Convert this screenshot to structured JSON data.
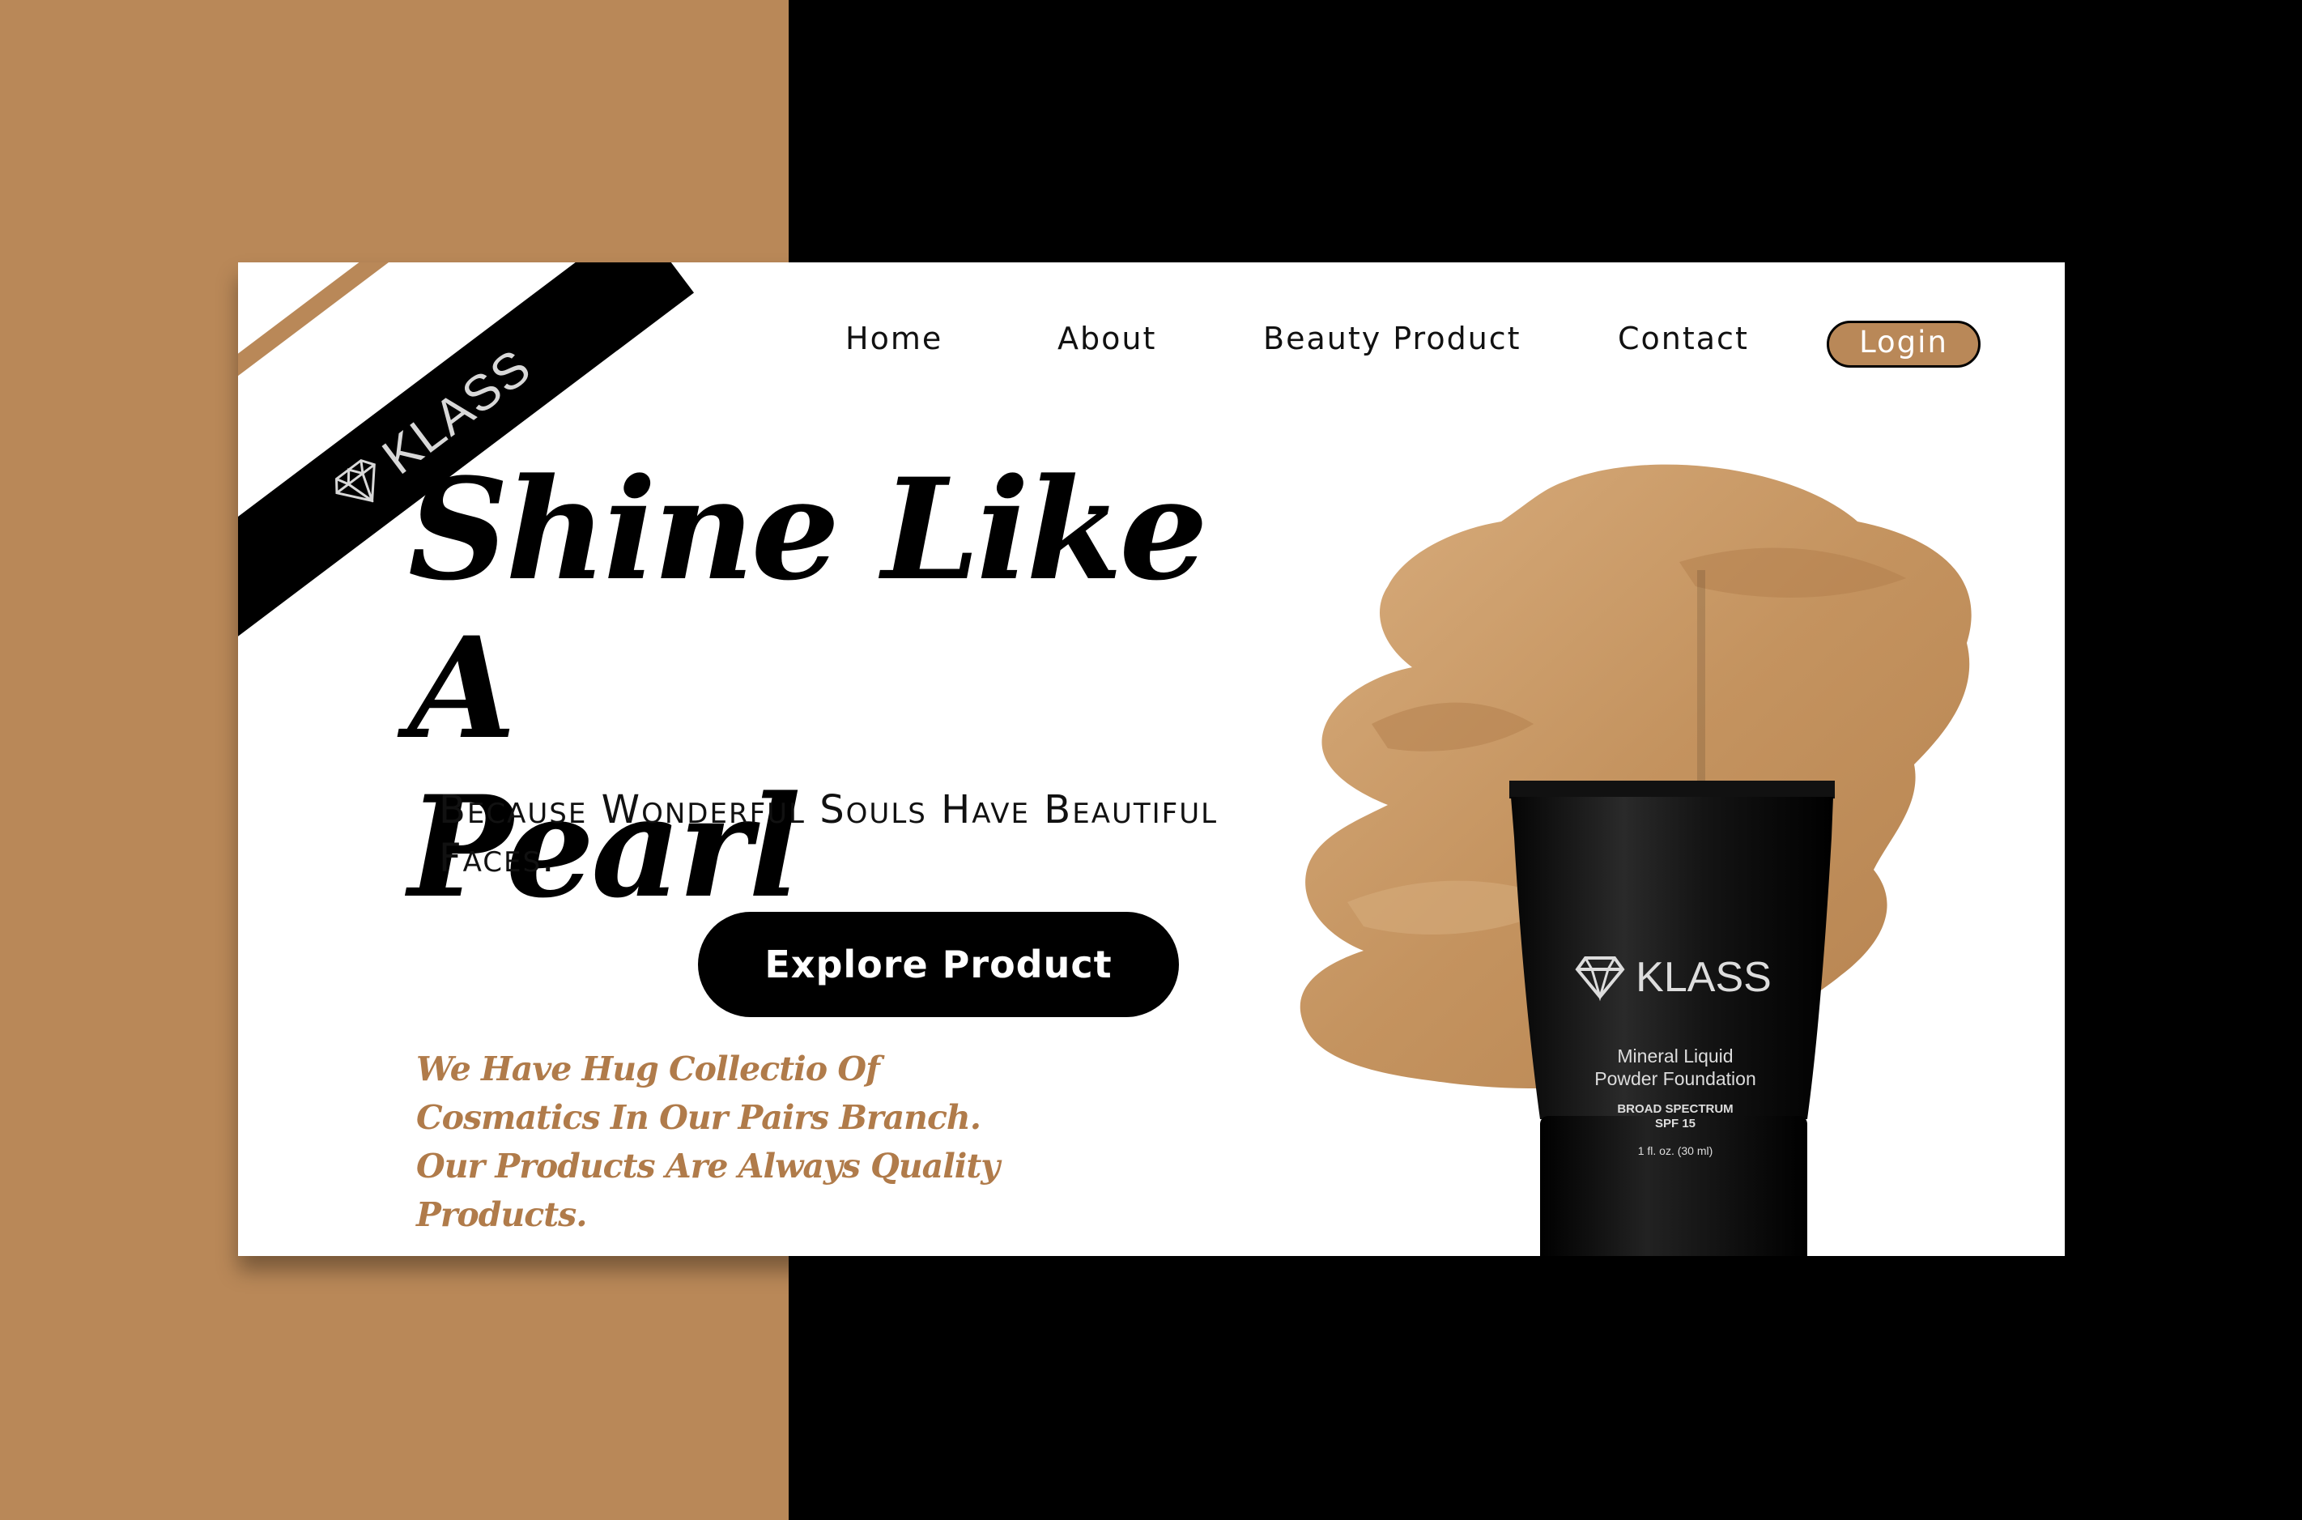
{
  "brand": {
    "name": "KLASS"
  },
  "nav": {
    "items": [
      {
        "label": "Home"
      },
      {
        "label": "About"
      },
      {
        "label": "Beauty Product"
      },
      {
        "label": "Contact"
      }
    ],
    "login_label": "Login"
  },
  "hero": {
    "headline_line1": "Shine Like A",
    "headline_line2": "Pearl",
    "tagline": "Because Wonderful Souls Have Beautiful Faces.",
    "cta_label": "Explore Product",
    "description": "We Have Hug Collectio Of Cosmatics In Our Pairs Branch. Our Products Are Always Quality Products."
  },
  "product": {
    "brand": "KLASS",
    "line1": "Mineral Liquid",
    "line2": "Powder Foundation",
    "line3": "BROAD SPECTRUM",
    "line4": "SPF 15",
    "size": "1 fl. oz. (30 ml)"
  },
  "colors": {
    "accent": "#B98858",
    "dark": "#000000",
    "card": "#FFFFFF",
    "description_text": "#B07B4A"
  }
}
